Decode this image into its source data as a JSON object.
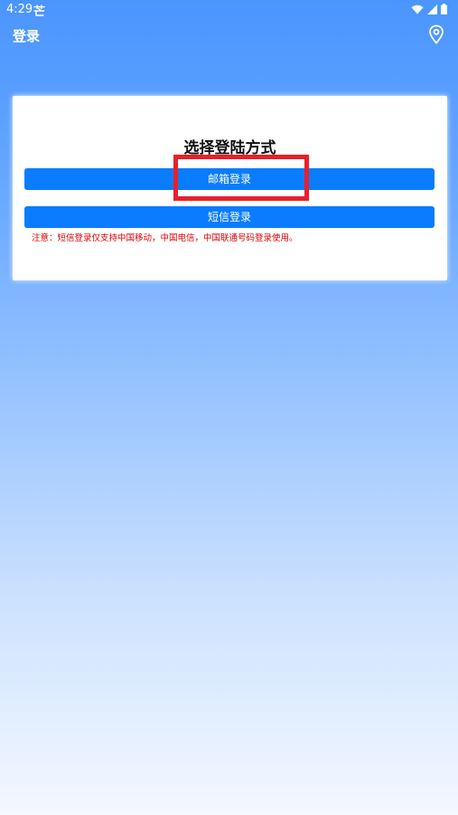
{
  "status_bar": {
    "time": "4:29",
    "sim_icon_glyph": "芒",
    "icons": [
      "wifi-icon",
      "signal-icon",
      "battery-icon"
    ]
  },
  "app_bar": {
    "title": "登录",
    "location_icon": "location-pin-icon"
  },
  "card": {
    "title": "选择登陆方式",
    "email_login_label": "邮箱登录",
    "sms_login_label": "短信登录",
    "notice": "注意：短信登录仅支持中国移动，中国电信，中国联通号码登录使用。"
  },
  "colors": {
    "primary_button": "#0a7cff",
    "notice_text": "#e00000",
    "highlight": "#e8202a",
    "gradient_top": "#4a95ff",
    "gradient_bottom": "#f4f8ff"
  }
}
